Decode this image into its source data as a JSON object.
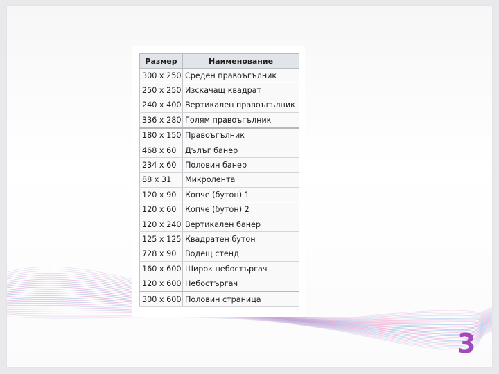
{
  "table": {
    "headers": [
      "Размер",
      "Наименование"
    ],
    "rows": [
      {
        "size": "300 x 250",
        "name": "Среден правоъгълник"
      },
      {
        "size": "250 x 250",
        "name": "Изскачащ квадрат"
      },
      {
        "size": "240 x 400",
        "name": "Вертикален правоъгълник"
      },
      {
        "size": "336 x 280",
        "name": "Голям правоъгълник"
      },
      {
        "size": "180 x 150",
        "name": "Правоъгълник"
      },
      {
        "size": "468 x 60",
        "name": "Дълъг банер"
      },
      {
        "size": "234 x 60",
        "name": "Половин банер"
      },
      {
        "size": "88 x 31",
        "name": "Микролента"
      },
      {
        "size": "120 x 90",
        "name": "Копче (бутон) 1"
      },
      {
        "size": "120 x 60",
        "name": "Копче (бутон) 2"
      },
      {
        "size": "120 x 240",
        "name": "Вертикален банер"
      },
      {
        "size": "125 x 125",
        "name": "Квадратен бутон"
      },
      {
        "size": "728 x 90",
        "name": "Водещ стенд"
      },
      {
        "size": "160 x 600",
        "name": "Широк небостъргач"
      },
      {
        "size": "120 x 600",
        "name": "Небостъргач"
      },
      {
        "size": "300 x 600",
        "name": "Половин страница"
      }
    ]
  },
  "page_number": "3",
  "colors": {
    "accent": "#a14ab9",
    "wave_pink": "#e24fa8",
    "wave_blue": "#5a8fd8",
    "header_bg": "#e1e4e8"
  }
}
